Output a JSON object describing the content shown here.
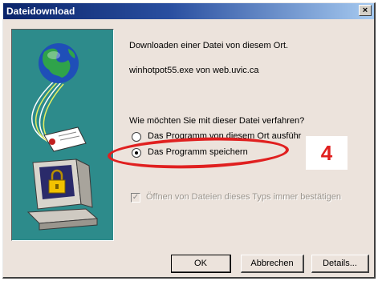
{
  "window": {
    "title": "Dateidownload",
    "close_glyph": "×"
  },
  "message": {
    "intro": "Downloaden einer Datei von diesem Ort.",
    "file": "winhotpot55.exe von web.uvic.ca",
    "question": "Wie möchten Sie mit dieser Datei verfahren?"
  },
  "options": {
    "run_label": "Das Programm von diesem Ort ausführ",
    "save_label": "Das Programm speichern",
    "selected": "save"
  },
  "confirm": {
    "label": "Öffnen von Dateien dieses Typs immer bestätigen",
    "checked": true,
    "disabled": true
  },
  "buttons": {
    "ok": "OK",
    "cancel": "Abbrechen",
    "details": "Details..."
  },
  "annotation": {
    "step_number": "4",
    "color": "#e02020"
  },
  "icons": [
    "globe-icon",
    "document-icon",
    "computer-icon",
    "padlock-icon"
  ]
}
